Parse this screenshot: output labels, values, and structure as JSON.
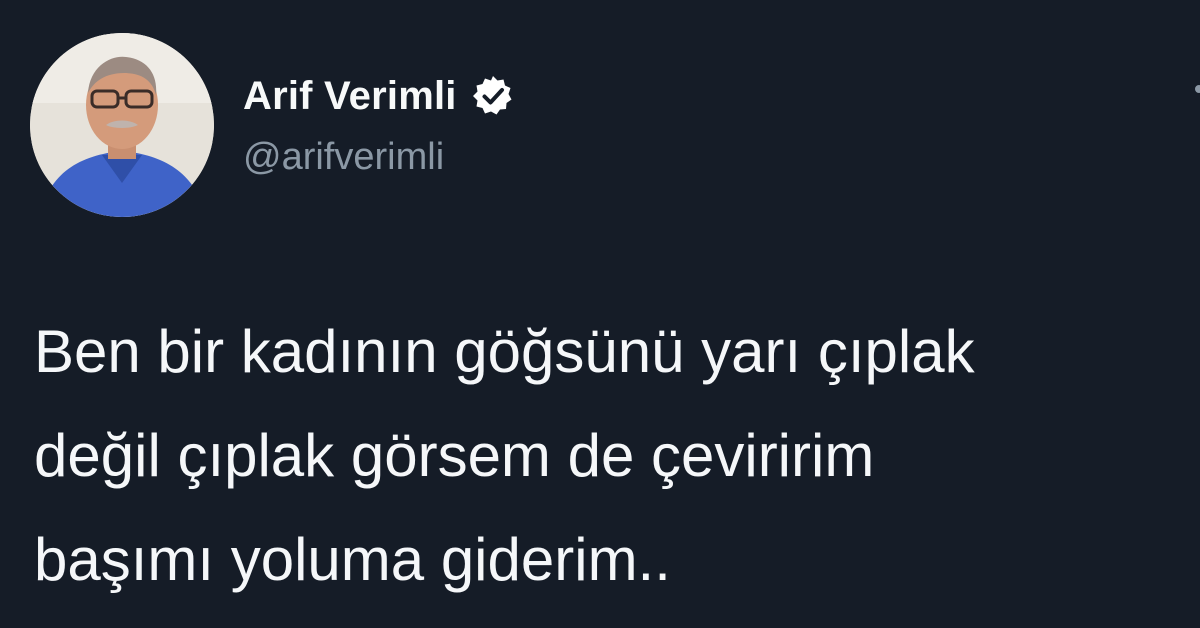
{
  "tweet": {
    "author": {
      "display_name": "Arif Verimli",
      "handle": "@arifverimli",
      "verified_icon": "verified-badge-icon",
      "avatar_icon": "profile-photo"
    },
    "text_lines": [
      "Ben bir kadının göğsünü yarı çıplak",
      "değil çıplak görsem de çeviririm",
      "başımı yoluma giderim.."
    ],
    "more_icon": "more-options-icon"
  },
  "colors": {
    "background": "#151c27",
    "text": "#f5f7f9",
    "handle": "#8b98a5",
    "verified_badge": "#ffffff"
  }
}
